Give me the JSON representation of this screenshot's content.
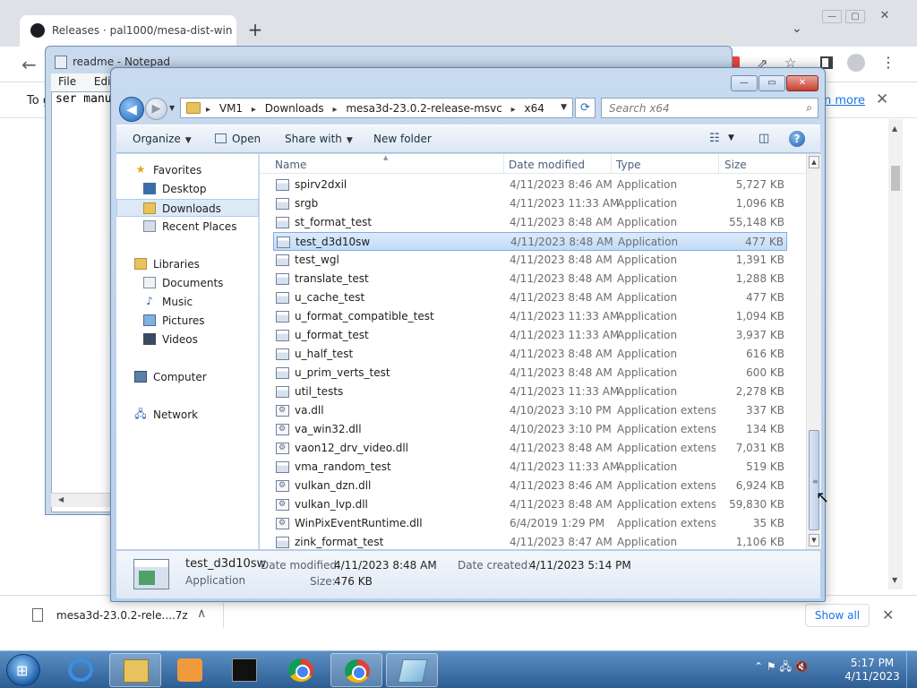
{
  "chrome": {
    "tab_title": "Releases · pal1000/mesa-dist-win",
    "new_tab": "+",
    "tab_menu": "⌄",
    "win_min": "—",
    "win_max": "▢",
    "win_close": "✕",
    "back": "←",
    "infobar_prefix": "To g",
    "infobar_more": "n more",
    "infobar_close": "✕",
    "download_file": "mesa3d-23.0.2-rele....7z",
    "download_chevron": "∧",
    "show_all": "Show all",
    "download_close": "✕"
  },
  "notepad": {
    "title": "readme - Notepad",
    "menu": [
      "File",
      "Edit"
    ],
    "text": "ser manu"
  },
  "explorer": {
    "win_min": "—",
    "win_max": "▭",
    "win_close": "✕",
    "nav_back": "◀",
    "nav_forward": "▶",
    "recent_arrow": "▼",
    "breadcrumbs": [
      "VM1",
      "Downloads",
      "mesa3d-23.0.2-release-msvc",
      "x64"
    ],
    "breadcrumb_arrow": "▸",
    "address_dropdown": "▼",
    "refresh": "⟳",
    "search_placeholder": "Search x64",
    "search_icon": "⌕",
    "commands": {
      "organize": "Organize",
      "open": "Open",
      "share_with": "Share with",
      "new_folder": "New folder",
      "caret": "▼"
    },
    "view_icon": "☷",
    "preview_icon": "◫",
    "help": "?",
    "nav": {
      "favorites": "Favorites",
      "desktop": "Desktop",
      "downloads": "Downloads",
      "recent_places": "Recent Places",
      "libraries": "Libraries",
      "documents": "Documents",
      "music": "Music",
      "pictures": "Pictures",
      "videos": "Videos",
      "computer": "Computer",
      "network": "Network"
    },
    "columns": {
      "name": "Name",
      "date_modified": "Date modified",
      "type": "Type",
      "size": "Size"
    },
    "files": [
      {
        "name": "spirv2dxil",
        "date": "4/11/2023 8:46 AM",
        "type": "Application",
        "size": "5,727 KB"
      },
      {
        "name": "srgb",
        "date": "4/11/2023 11:33 AM",
        "type": "Application",
        "size": "1,096 KB"
      },
      {
        "name": "st_format_test",
        "date": "4/11/2023 8:48 AM",
        "type": "Application",
        "size": "55,148 KB"
      },
      {
        "name": "test_d3d10sw",
        "date": "4/11/2023 8:48 AM",
        "type": "Application",
        "size": "477 KB"
      },
      {
        "name": "test_wgl",
        "date": "4/11/2023 8:48 AM",
        "type": "Application",
        "size": "1,391 KB"
      },
      {
        "name": "translate_test",
        "date": "4/11/2023 8:48 AM",
        "type": "Application",
        "size": "1,288 KB"
      },
      {
        "name": "u_cache_test",
        "date": "4/11/2023 8:48 AM",
        "type": "Application",
        "size": "477 KB"
      },
      {
        "name": "u_format_compatible_test",
        "date": "4/11/2023 11:33 AM",
        "type": "Application",
        "size": "1,094 KB"
      },
      {
        "name": "u_format_test",
        "date": "4/11/2023 11:33 AM",
        "type": "Application",
        "size": "3,937 KB"
      },
      {
        "name": "u_half_test",
        "date": "4/11/2023 8:48 AM",
        "type": "Application",
        "size": "616 KB"
      },
      {
        "name": "u_prim_verts_test",
        "date": "4/11/2023 8:48 AM",
        "type": "Application",
        "size": "600 KB"
      },
      {
        "name": "util_tests",
        "date": "4/11/2023 11:33 AM",
        "type": "Application",
        "size": "2,278 KB"
      },
      {
        "name": "va.dll",
        "date": "4/10/2023 3:10 PM",
        "type": "Application extens...",
        "size": "337 KB"
      },
      {
        "name": "va_win32.dll",
        "date": "4/10/2023 3:10 PM",
        "type": "Application extens...",
        "size": "134 KB"
      },
      {
        "name": "vaon12_drv_video.dll",
        "date": "4/11/2023 8:48 AM",
        "type": "Application extens...",
        "size": "7,031 KB"
      },
      {
        "name": "vma_random_test",
        "date": "4/11/2023 11:33 AM",
        "type": "Application",
        "size": "519 KB"
      },
      {
        "name": "vulkan_dzn.dll",
        "date": "4/11/2023 8:46 AM",
        "type": "Application extens...",
        "size": "6,924 KB"
      },
      {
        "name": "vulkan_lvp.dll",
        "date": "4/11/2023 8:48 AM",
        "type": "Application extens...",
        "size": "59,830 KB"
      },
      {
        "name": "WinPixEventRuntime.dll",
        "date": "6/4/2019 1:29 PM",
        "type": "Application extens...",
        "size": "35 KB"
      },
      {
        "name": "zink_format_test",
        "date": "4/11/2023 8:47 AM",
        "type": "Application",
        "size": "1,106 KB"
      }
    ],
    "details": {
      "name": "test_d3d10sw",
      "type": "Application",
      "date_modified_label": "Date modified:",
      "date_modified": "4/11/2023 8:48 AM",
      "date_created_label": "Date created:",
      "date_created": "4/11/2023 5:14 PM",
      "size_label": "Size:",
      "size": "476 KB"
    }
  },
  "taskbar": {
    "start_glyph": "⊞",
    "tray": "⌃  ⚑  🖧  🔇",
    "time": "5:17 PM",
    "date": "4/11/2023"
  }
}
